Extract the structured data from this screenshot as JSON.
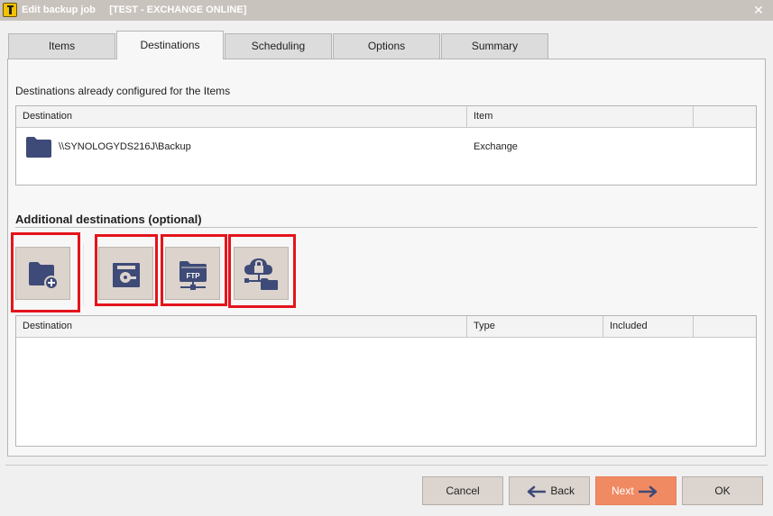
{
  "window": {
    "title": "Edit backup job",
    "subtitle": "[TEST - EXCHANGE ONLINE]",
    "close_label": "✕"
  },
  "tabs": [
    {
      "label": "Items"
    },
    {
      "label": "Destinations"
    },
    {
      "label": "Scheduling"
    },
    {
      "label": "Options"
    },
    {
      "label": "Summary"
    }
  ],
  "configured": {
    "label": "Destinations already configured for the Items",
    "columns": [
      "Destination",
      "Item"
    ],
    "rows": [
      {
        "destination": "\\\\SYNOLOGYDS216J\\Backup",
        "item": "Exchange"
      }
    ]
  },
  "additional": {
    "label": "Additional destinations (optional)",
    "ftp_icon_text": "FTP",
    "columns": [
      "Destination",
      "Type",
      "Included"
    ]
  },
  "buttons": {
    "cancel": "Cancel",
    "back": "Back",
    "next": "Next",
    "ok": "OK"
  },
  "colors": {
    "accent": "#f08a63",
    "highlight": "#e4141c",
    "icon": "#3e4a77"
  }
}
